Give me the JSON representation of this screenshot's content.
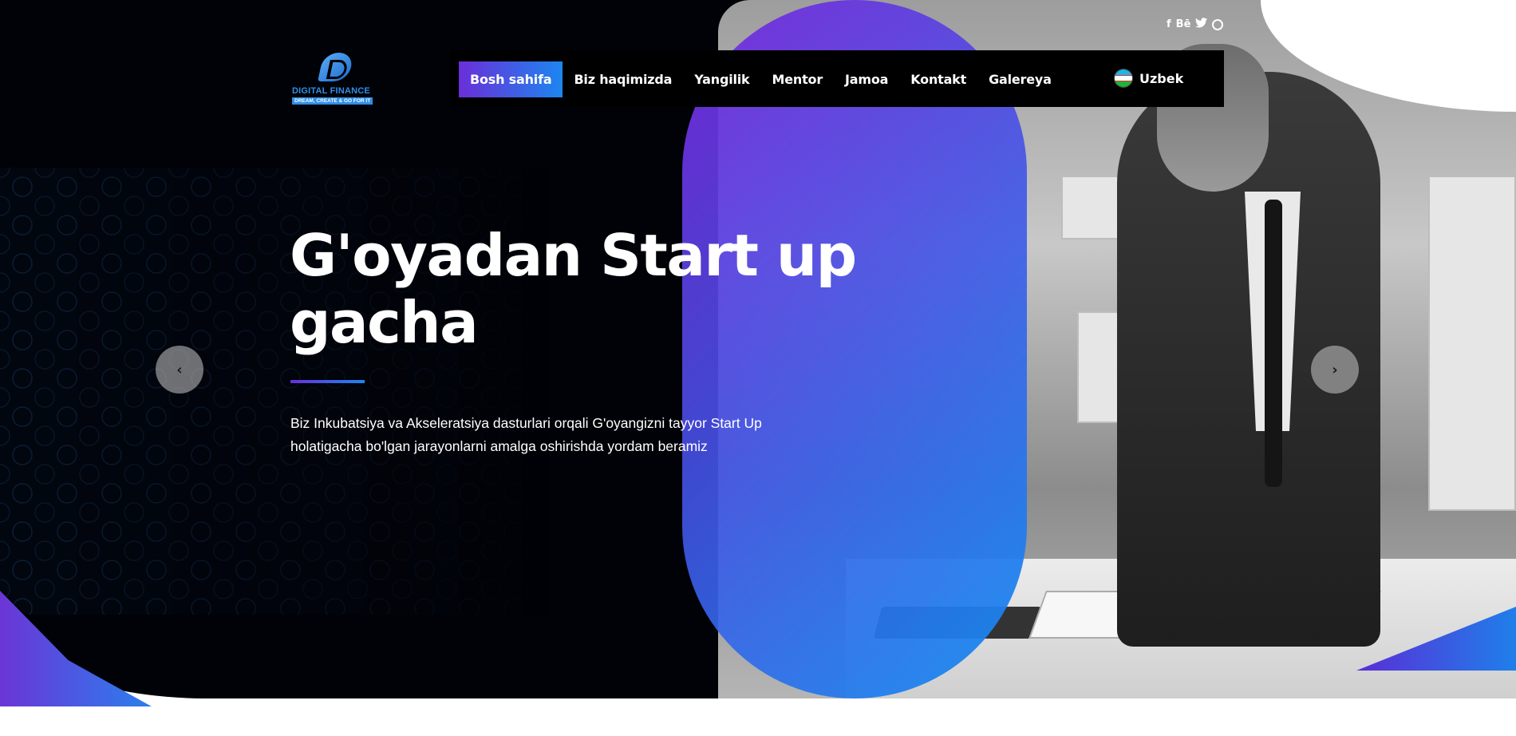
{
  "brand": {
    "name": "DIGITAL FINANCE",
    "tagline": "DREAM, CREATE & GO FOR IT"
  },
  "social": {
    "facebook": "f",
    "behance": "Bē",
    "twitter": "🐦"
  },
  "nav": {
    "items": [
      {
        "label": "Bosh sahifa",
        "active": true
      },
      {
        "label": "Biz haqimizda",
        "active": false
      },
      {
        "label": "Yangilik",
        "active": false
      },
      {
        "label": "Mentor",
        "active": false
      },
      {
        "label": "Jamoa",
        "active": false
      },
      {
        "label": "Kontakt",
        "active": false
      },
      {
        "label": "Galereya",
        "active": false
      }
    ],
    "language": "Uzbek"
  },
  "hero": {
    "title_line1": "G'oyadan Start up",
    "title_line2": "gacha",
    "description": "Biz Inkubatsiya va Akseleratsiya dasturlari orqali G'oyangizni tayyor Start Up holatigacha bo'lgan jarayonlarni amalga oshirishda yordam beramiz",
    "prev_arrow": "‹",
    "next_arrow": "›"
  },
  "colors": {
    "accent_purple": "#6a2ed9",
    "accent_blue": "#1d86ef",
    "background": "#000207"
  },
  "icons": [
    "facebook-icon",
    "behance-icon",
    "twitter-icon",
    "dribbble-icon",
    "uzbekistan-flag-icon",
    "chevron-left-icon",
    "chevron-right-icon"
  ]
}
